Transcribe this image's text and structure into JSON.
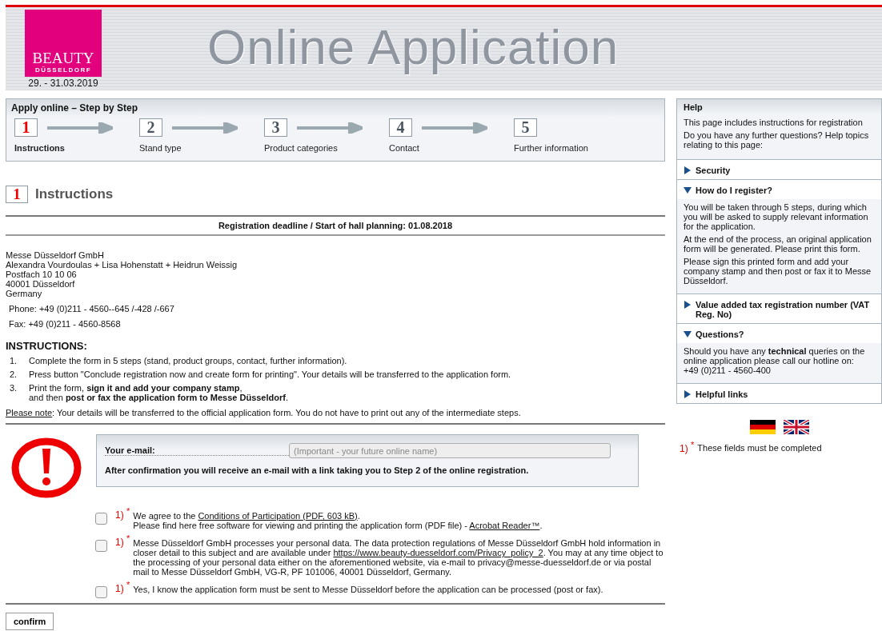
{
  "header": {
    "logo_text": "BEAUTY",
    "logo_subtext": "DÜSSELDORF",
    "date": "29. - 31.03.2019",
    "title": "Online Application"
  },
  "steps": {
    "title": "Apply online – Step by Step",
    "items": [
      {
        "number": "1",
        "label": "Instructions",
        "selected": true
      },
      {
        "number": "2",
        "label": "Stand type",
        "selected": false
      },
      {
        "number": "3",
        "label": "Product categories",
        "selected": false
      },
      {
        "number": "4",
        "label": "Contact",
        "selected": false
      },
      {
        "number": "5",
        "label": "Further information",
        "selected": false
      }
    ]
  },
  "section": {
    "number": "1",
    "title": "Instructions"
  },
  "deadline": "Registration deadline / Start of hall planning: 01.08.2018",
  "address": [
    "Messe Düsseldorf GmbH",
    "Alexandra Vourdoulas + Lisa Hohenstatt + Heidrun Weissig",
    "Postfach 10 10 06",
    "40001 Düsseldorf",
    "Germany"
  ],
  "phone": "Phone: +49 (0)211 - 4560--645 /-428 /-667",
  "fax": "Fax: +49 (0)211 - 4560-8568",
  "instructions": {
    "heading": "INSTRUCTIONS:",
    "items": [
      {
        "number": "1.",
        "text": "Complete the form in 5 steps (stand, product groups, contact, further information)."
      },
      {
        "number": "2.",
        "text": "Press button \"Conclude registration now and create form for printing\". Your details will be transferred to the application form."
      },
      {
        "number": "3.",
        "text": "Print the form, **sign it and add your company stamp**,\nand then **post or fax the application form to Messe Düsseldorf**."
      }
    ],
    "note_label": "Please note",
    "note_text": ": Your details will be transferred to the official application form. You do not have to print out any of the intermediate steps."
  },
  "email": {
    "label": "Your e-mail:",
    "placeholder": "(Important - your future online name)",
    "info": "After confirmation you will receive an e-mail with a link taking you to Step 2 of the online registration."
  },
  "consents": [
    {
      "marker": "1)",
      "star": "*",
      "checked": false,
      "parts": [
        {
          "kind": "text",
          "text": "We agree to the "
        },
        {
          "kind": "link",
          "text": "Conditions of Participation (PDF, 603 kB)"
        },
        {
          "kind": "text",
          "text": "."
        },
        {
          "kind": "break"
        },
        {
          "kind": "text",
          "text": "Please find here free software for viewing and printing the application form (PDF file) - "
        },
        {
          "kind": "link",
          "text": "Acrobat Reader™"
        },
        {
          "kind": "text",
          "text": "."
        }
      ]
    },
    {
      "marker": "1)",
      "star": "*",
      "checked": false,
      "parts": [
        {
          "kind": "text",
          "text": "Messe Düsseldorf GmbH processes your personal data. The data protection regulations of Messe Düsseldorf GmbH hold information in closer detail to this subject and are available under "
        },
        {
          "kind": "link",
          "text": "https://www.beauty-duesseldorf.com/Privacy_policy_2"
        },
        {
          "kind": "text",
          "text": ". You may at any time object to the processing of your personal data either on the aforementioned website, via e-mail to privacy@messe-duesseldorf.de or via postal mail to Messe Düsseldorf GmbH, VG-R, PF 101006, 40001 Düsseldorf, Germany."
        }
      ]
    },
    {
      "marker": "1)",
      "star": "*",
      "checked": false,
      "parts": [
        {
          "kind": "text",
          "text": "Yes, I know the application form must be sent to Messe Düsseldorf before the application can be processed (post or fax)."
        }
      ]
    }
  ],
  "confirm_button": "confirm",
  "help": {
    "title": "Help",
    "intro": [
      "This page includes instructions for registration",
      "Do you have any further questions? Help topics relating to this page:"
    ],
    "topics": [
      {
        "title": "Security",
        "expanded": false
      },
      {
        "title": "How do I register?",
        "expanded": true,
        "paragraphs": [
          "You will be taken through 5 steps, during which you will be asked to supply relevant information for the application.",
          "At the end of the process, an original application form will be generated. Please print this form.",
          "Please sign this printed form and add your company stamp and then post or fax it to Messe Düsseldorf."
        ]
      },
      {
        "title": "Value added tax registration number (VAT Reg. No)",
        "expanded": false
      },
      {
        "title": "Questions?",
        "expanded": true,
        "paragraphs": [
          "Should you have any **technical** queries on the online application please call our hotline on:\n+49 (0)211 - 4560-400"
        ]
      },
      {
        "title": "Helpful links",
        "expanded": false
      }
    ]
  },
  "required_note": {
    "marker": "1)",
    "star": "*",
    "text": "These fields must be completed"
  }
}
